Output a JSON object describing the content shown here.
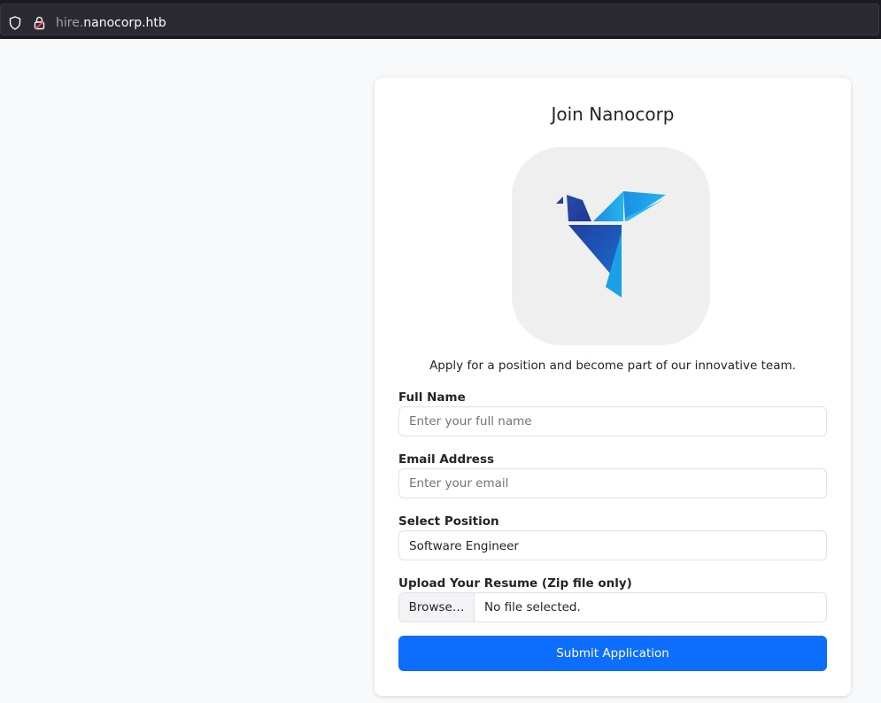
{
  "browser": {
    "url_subdomain": "hire.",
    "url_domain": "nanocorp.htb"
  },
  "card": {
    "title": "Join Nanocorp",
    "tagline": "Apply for a position and become part of our innovative team."
  },
  "form": {
    "full_name": {
      "label": "Full Name",
      "placeholder": "Enter your full name",
      "value": ""
    },
    "email": {
      "label": "Email Address",
      "placeholder": "Enter your email",
      "value": ""
    },
    "position": {
      "label": "Select Position",
      "selected": "Software Engineer"
    },
    "resume": {
      "label": "Upload Your Resume (Zip file only)",
      "browse_label": "Browse…",
      "status": "No file selected."
    },
    "submit_label": "Submit Application"
  },
  "colors": {
    "primary": "#0d6efd",
    "logo_dark_blue": "#1f3f9f",
    "logo_light_blue": "#1aa0e6"
  },
  "icons": {
    "tracking": "shield-icon",
    "connection": "lock-icon",
    "logo": "origami-bird-logo"
  }
}
